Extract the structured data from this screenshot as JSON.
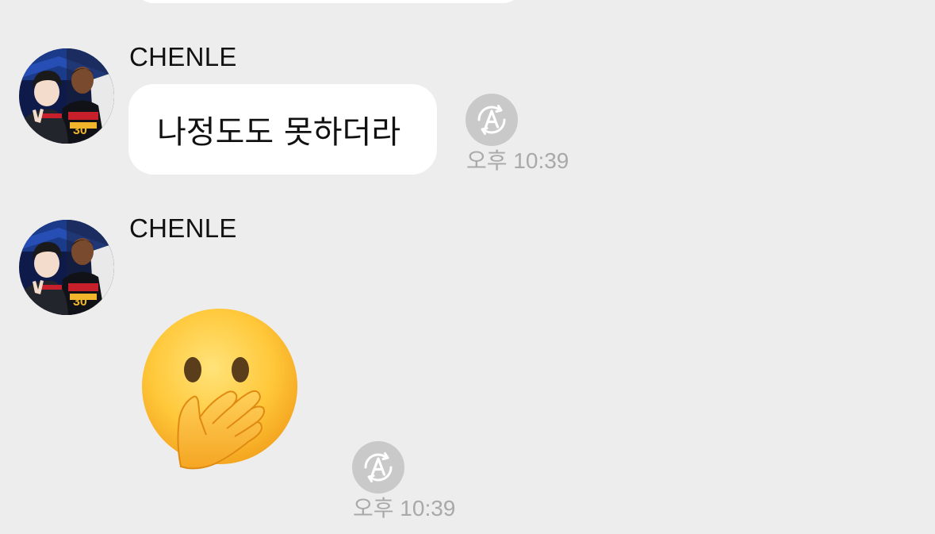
{
  "messages": [
    {
      "sender": "CHENLE",
      "text": "나정도도 못하더라",
      "time": "오후 10:39",
      "avatar_icon": "profile-photo-icon",
      "action_icon": "auto-translate-icon"
    },
    {
      "sender": "CHENLE",
      "emoji": "face-with-hand-over-mouth",
      "time": "오후 10:39",
      "avatar_icon": "profile-photo-icon",
      "action_icon": "auto-translate-icon"
    }
  ],
  "colors": {
    "background": "#ededed",
    "bubble": "#ffffff",
    "timestamp": "#a9a9a9",
    "translate_button": "#c9c9c9"
  }
}
